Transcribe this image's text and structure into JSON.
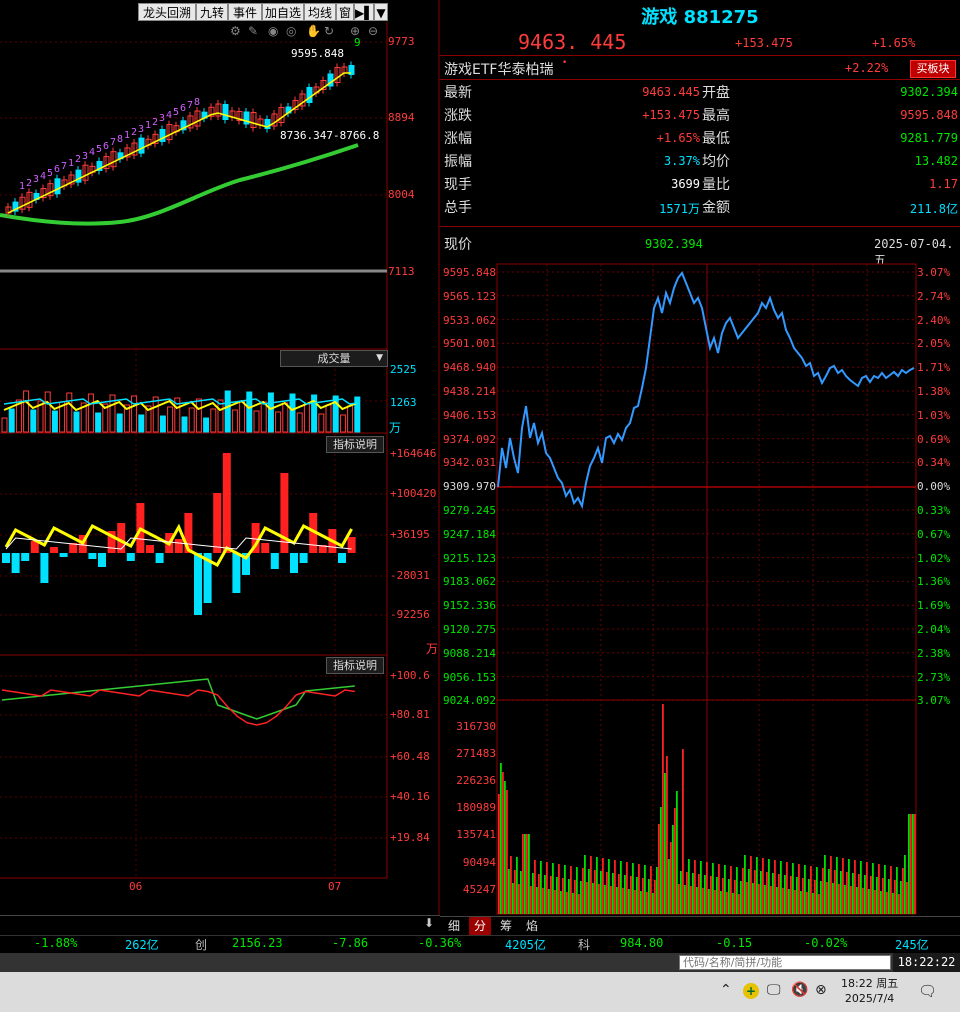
{
  "toolbar": {
    "items": [
      "龙头回溯",
      "九转",
      "事件",
      "加自选",
      "均线",
      "窗"
    ],
    "arrow_label": "▶▌",
    "dropdown_label": "▼"
  },
  "kline": {
    "price_high_label": "9595.848",
    "ma_label": "8736.347-8766.8",
    "y_ticks": [
      "9773",
      "8894",
      "8004",
      "7113"
    ],
    "nine_seq_red": [
      "1",
      "2",
      "3",
      "4",
      "5",
      "6",
      "7",
      "1",
      "2",
      "3",
      "4",
      "5",
      "6",
      "7",
      "8",
      "1",
      "2",
      "3",
      "1",
      "2",
      "3",
      "4",
      "5",
      "6",
      "7",
      "8"
    ],
    "nine_label": "9"
  },
  "volume_panel": {
    "title": "成交量",
    "y_ticks": [
      "2525",
      "1263"
    ],
    "unit": "万"
  },
  "macd_panel": {
    "button": "指标说明",
    "y_ticks": [
      "+164646",
      "+100420",
      "+36195",
      "-28031",
      "-92256"
    ],
    "unit": "万"
  },
  "kdj_panel": {
    "button": "指标说明",
    "y_ticks": [
      "+100.6",
      "+80.81",
      "+60.48",
      "+40.16",
      "+19.84"
    ]
  },
  "month_labels": [
    "06",
    "07"
  ],
  "quote": {
    "name": "游戏",
    "code": "881275",
    "price": "9463. 445",
    "change": "+153.475",
    "change_pct": "+1.65%",
    "etf_name": "游戏ETF华泰柏瑞",
    "etf_pct": "+2.22%",
    "buy_button": "买板块",
    "rows": [
      {
        "l1": "最新",
        "v1": "9463.445",
        "c1": "red",
        "l2": "开盘",
        "v2": "9302.394",
        "c2": "green"
      },
      {
        "l1": "涨跌",
        "v1": "+153.475",
        "c1": "red",
        "l2": "最高",
        "v2": "9595.848",
        "c2": "red"
      },
      {
        "l1": "涨幅",
        "v1": "+1.65%",
        "c1": "red",
        "l2": "最低",
        "v2": "9281.779",
        "c2": "green"
      },
      {
        "l1": "振幅",
        "v1": "3.37%",
        "c1": "cyan",
        "l2": "均价",
        "v2": "13.482",
        "c2": "green"
      },
      {
        "l1": "现手",
        "v1": "3699",
        "c1": "white",
        "l2": "量比",
        "v2": "1.17",
        "c2": "red"
      },
      {
        "l1": "总手",
        "v1": "1571万",
        "c1": "cyan",
        "l2": "金额",
        "v2": "211.8亿",
        "c2": "cyan"
      }
    ]
  },
  "intraday": {
    "label_current": "现价",
    "current_value": "9302.394",
    "date": "2025-07-04. 五",
    "left_ticks": [
      "9595.848",
      "9565.123",
      "9533.062",
      "9501.001",
      "9468.940",
      "9438.214",
      "9406.153",
      "9374.092",
      "9342.031",
      "9309.970",
      "9279.245",
      "9247.184",
      "9215.123",
      "9183.062",
      "9152.336",
      "9120.275",
      "9088.214",
      "9056.153",
      "9024.092"
    ],
    "right_ticks": [
      "3.07%",
      "2.74%",
      "2.40%",
      "2.05%",
      "1.71%",
      "1.38%",
      "1.03%",
      "0.69%",
      "0.34%",
      "0.00%",
      "0.33%",
      "0.67%",
      "1.02%",
      "1.36%",
      "1.69%",
      "2.04%",
      "2.38%",
      "2.73%",
      "3.07%"
    ],
    "vol_ticks": [
      "316730",
      "271483",
      "226236",
      "180989",
      "135741",
      "90494",
      "45247"
    ],
    "tabs": [
      "细",
      "分",
      "筹",
      "焰"
    ]
  },
  "bottom_ticker": [
    {
      "text": "-1.88%",
      "color": "green"
    },
    {
      "text": "262亿",
      "color": "cyan"
    },
    {
      "text": "创",
      "color": "gray"
    },
    {
      "text": "2156.23",
      "color": "green"
    },
    {
      "text": "-7.86",
      "color": "green"
    },
    {
      "text": "-0.36%",
      "color": "green"
    },
    {
      "text": "4205亿",
      "color": "cyan"
    },
    {
      "text": "科",
      "color": "gray"
    },
    {
      "text": "984.80",
      "color": "green"
    },
    {
      "text": "-0.15",
      "color": "green"
    },
    {
      "text": "-0.02%",
      "color": "green"
    },
    {
      "text": "245亿",
      "color": "cyan"
    }
  ],
  "search_placeholder": "代码/名称/简拼/功能",
  "clock": "18:22:22",
  "taskbar": {
    "time": "18:22 周五",
    "date": "2025/7/4"
  },
  "colors": {
    "up": "#ff3c3c",
    "down": "#00e600",
    "grid": "#7a0000",
    "price_line": "#3399ff",
    "ma": "#33cc33"
  }
}
